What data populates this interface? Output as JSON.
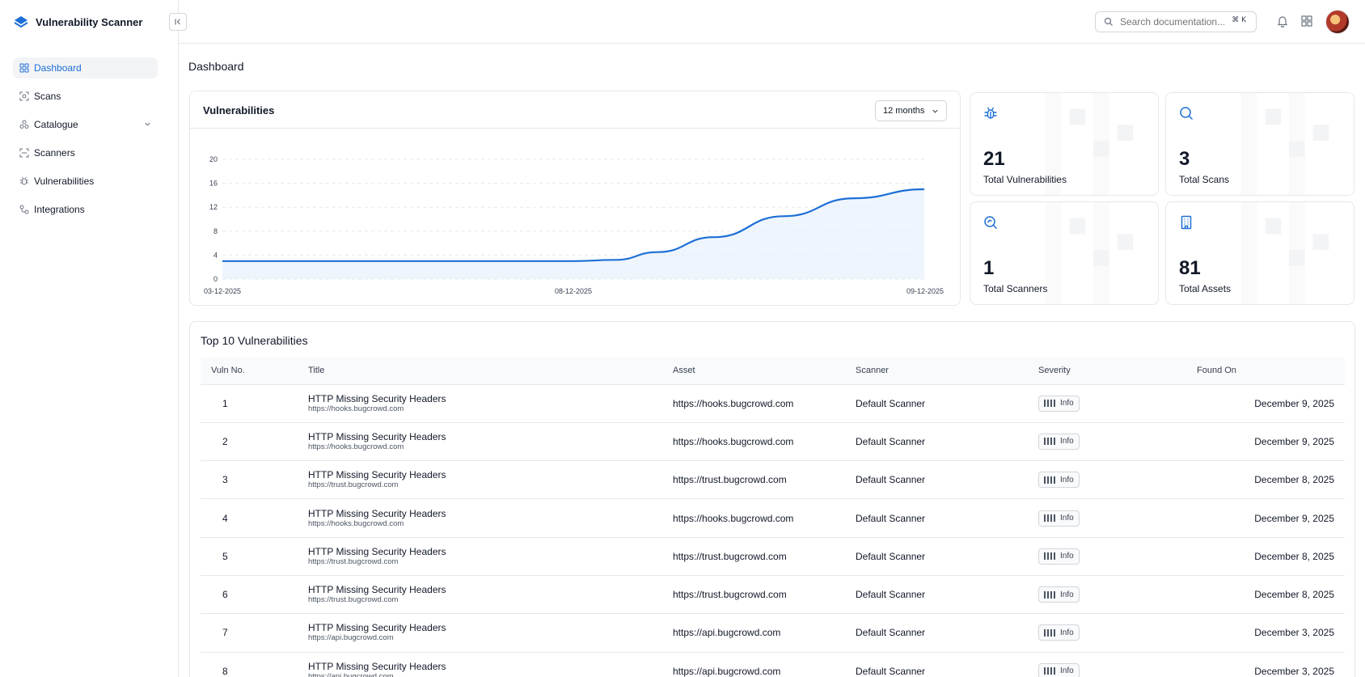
{
  "app": {
    "name": "Vulnerability Scanner"
  },
  "sidebar": {
    "items": [
      {
        "label": "Dashboard",
        "icon": "dashboard-icon",
        "active": true
      },
      {
        "label": "Scans",
        "icon": "scan-icon"
      },
      {
        "label": "Catalogue",
        "icon": "catalogue-icon",
        "expandable": true
      },
      {
        "label": "Scanners",
        "icon": "scanner-icon"
      },
      {
        "label": "Vulnerabilities",
        "icon": "bug-icon"
      },
      {
        "label": "Integrations",
        "icon": "integrations-icon"
      }
    ]
  },
  "topbar": {
    "search_placeholder": "Search documentation...",
    "search_shortcut": "⌘ K"
  },
  "page": {
    "title": "Dashboard"
  },
  "vuln_chart": {
    "title": "Vulnerabilities",
    "period": "12 months"
  },
  "chart_data": {
    "type": "area",
    "title": "Vulnerabilities",
    "x_tick_labels": [
      "03-12-2025",
      "08-12-2025",
      "09-12-2025"
    ],
    "y_ticks": [
      0,
      4,
      8,
      12,
      16,
      20
    ],
    "ylim": [
      0,
      20
    ],
    "series": [
      {
        "x": [
          0,
          0.25,
          0.5,
          0.56,
          0.62,
          0.7,
          0.8,
          0.9,
          1.0
        ],
        "values": [
          3,
          3,
          3,
          3.2,
          4.5,
          7,
          10.5,
          13.5,
          15
        ]
      }
    ],
    "grid": "horizontal dashed",
    "color": "#1d6fd6"
  },
  "stats": [
    {
      "value": "21",
      "label": "Total Vulnerabilities",
      "icon": "bug-icon"
    },
    {
      "value": "3",
      "label": "Total Scans",
      "icon": "search-icon"
    },
    {
      "value": "1",
      "label": "Total Scanners",
      "icon": "scanner-search-icon"
    },
    {
      "value": "81",
      "label": "Total Assets",
      "icon": "building-icon"
    }
  ],
  "top_table": {
    "title": "Top 10 Vulnerabilities",
    "columns": [
      "Vuln No.",
      "Title",
      "Asset",
      "Scanner",
      "Severity",
      "Found On"
    ],
    "rows": [
      {
        "no": "1",
        "title": "HTTP Missing Security Headers",
        "url": "https://hooks.bugcrowd.com",
        "asset": "https://hooks.bugcrowd.com",
        "scanner": "Default Scanner",
        "severity": "Info",
        "found": "December 9, 2025"
      },
      {
        "no": "2",
        "title": "HTTP Missing Security Headers",
        "url": "https://hooks.bugcrowd.com",
        "asset": "https://hooks.bugcrowd.com",
        "scanner": "Default Scanner",
        "severity": "Info",
        "found": "December 9, 2025"
      },
      {
        "no": "3",
        "title": "HTTP Missing Security Headers",
        "url": "https://trust.bugcrowd.com",
        "asset": "https://trust.bugcrowd.com",
        "scanner": "Default Scanner",
        "severity": "Info",
        "found": "December 8, 2025"
      },
      {
        "no": "4",
        "title": "HTTP Missing Security Headers",
        "url": "https://hooks.bugcrowd.com",
        "asset": "https://hooks.bugcrowd.com",
        "scanner": "Default Scanner",
        "severity": "Info",
        "found": "December 9, 2025"
      },
      {
        "no": "5",
        "title": "HTTP Missing Security Headers",
        "url": "https://trust.bugcrowd.com",
        "asset": "https://trust.bugcrowd.com",
        "scanner": "Default Scanner",
        "severity": "Info",
        "found": "December 8, 2025"
      },
      {
        "no": "6",
        "title": "HTTP Missing Security Headers",
        "url": "https://trust.bugcrowd.com",
        "asset": "https://trust.bugcrowd.com",
        "scanner": "Default Scanner",
        "severity": "Info",
        "found": "December 8, 2025"
      },
      {
        "no": "7",
        "title": "HTTP Missing Security Headers",
        "url": "https://api.bugcrowd.com",
        "asset": "https://api.bugcrowd.com",
        "scanner": "Default Scanner",
        "severity": "Info",
        "found": "December 3, 2025"
      },
      {
        "no": "8",
        "title": "HTTP Missing Security Headers",
        "url": "https://api.bugcrowd.com",
        "asset": "https://api.bugcrowd.com",
        "scanner": "Default Scanner",
        "severity": "Info",
        "found": "December 3, 2025"
      }
    ]
  }
}
